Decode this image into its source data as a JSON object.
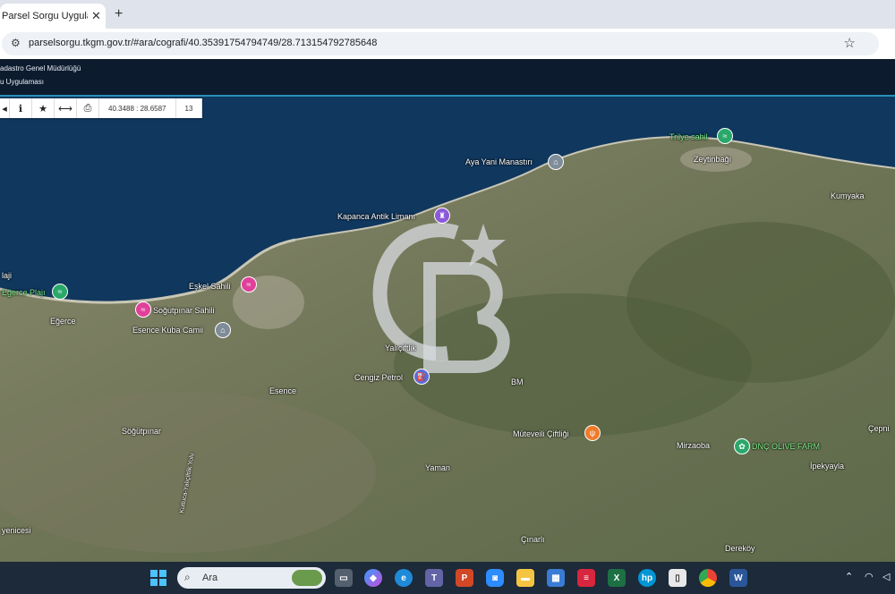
{
  "browser": {
    "tab_title": "Parsel Sorgu Uygulamas",
    "tab_close": "✕",
    "new_tab": "+",
    "url": "parselsorgu.tkgm.gov.tr/#ara/cografi/40.35391754794749/28.71315479278564​8"
  },
  "app": {
    "org_name": "adastro Genel Müdürlüğü",
    "app_name": "u Uygulaması"
  },
  "toolbar": {
    "coords": "40.3488 : 28.6587",
    "zoom": "13"
  },
  "map_labels": {
    "trilye": "Trilye sahil",
    "zeytinbagi": "Zeytinbağı",
    "aya_yani": "Aya Yani Manastırı",
    "kumyaka": "Kumyaka",
    "kapanca": "Kapanca Antik Limanı",
    "plaji": "laji",
    "egerce_plaji": "Eğerce Plajı",
    "eskel": "Eşkel Sahili",
    "sogutpinar_sahili": "Soğutpınar Sahili",
    "egerce": "Eğerce",
    "esence_kuba": "Esence Kuba Camii",
    "yalicitlik": "Yalıçiftlik",
    "cengiz": "Cengiz Petrol",
    "esence": "Esence",
    "sogutpinar": "Söğütpınar",
    "mutevelli": "Müteveili Çiftliği",
    "mirzaoba": "Mirzaoba",
    "dnc": "DNÇ OLIVE FARM",
    "cepni": "Çepni",
    "ipekyayla": "İpekyayla",
    "yaman": "Yaman",
    "cinarli": "Çınarlı",
    "derekoy": "Dereköy",
    "yenicesi": "yenicesi",
    "road": "Kutluca-Yalıçiftlik Yolu",
    "bm": "BM"
  },
  "taskbar": {
    "search_placeholder": "Ara"
  },
  "colors": {
    "header": "#0d1b2e",
    "accent": "#2a8fb8",
    "taskbar": "#1c2a3a"
  }
}
